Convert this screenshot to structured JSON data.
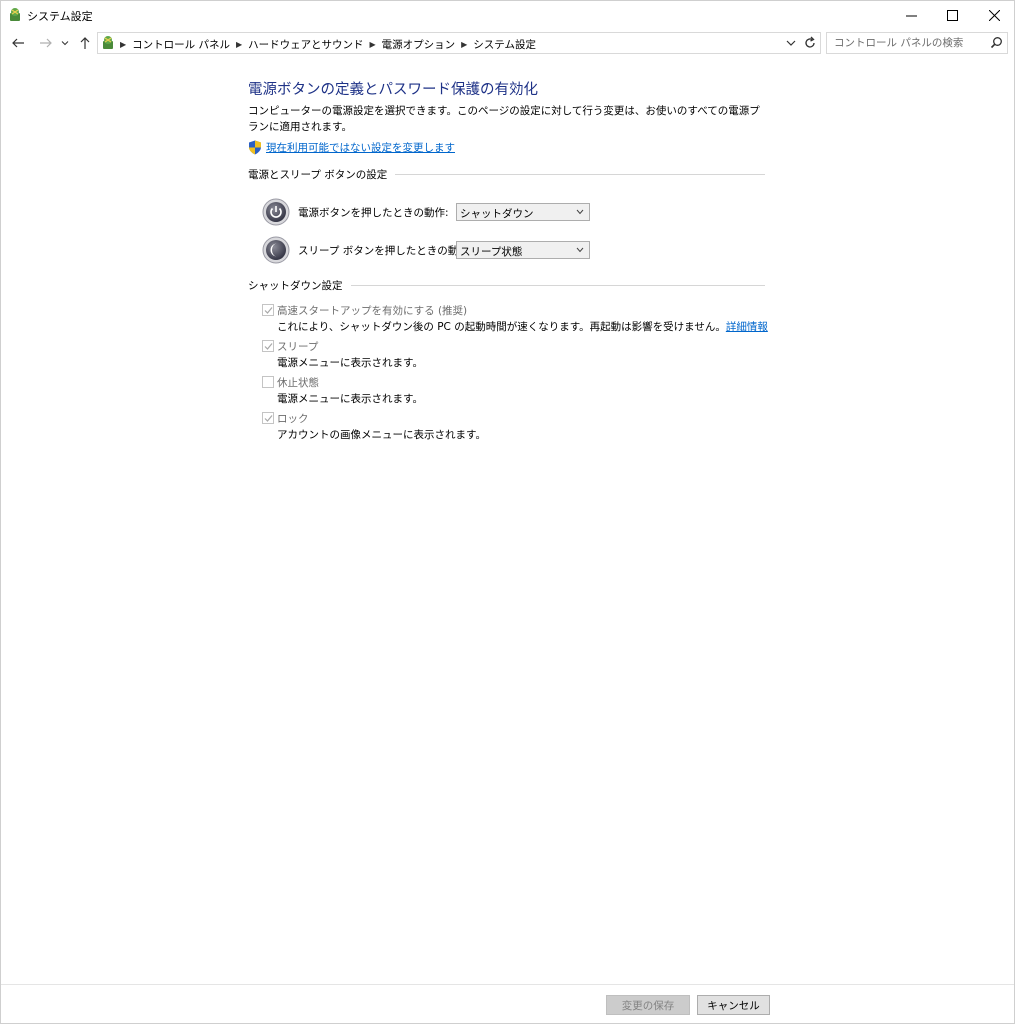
{
  "window": {
    "title": "システム設定"
  },
  "address": {
    "breadcrumbs": [
      "コントロール パネル",
      "ハードウェアとサウンド",
      "電源オプション",
      "システム設定"
    ],
    "search_placeholder": "コントロール パネルの検索"
  },
  "page": {
    "title": "電源ボタンの定義とパスワード保護の有効化",
    "description": "コンピューターの電源設定を選択できます。このページの設定に対して行う変更は、お使いのすべての電源プランに適用されます。",
    "admin_link": "現在利用可能ではない設定を変更します"
  },
  "power_section": {
    "title": "電源とスリープ ボタンの設定",
    "power_button_label": "電源ボタンを押したときの動作:",
    "power_button_value": "シャットダウン",
    "sleep_button_label": "スリープ ボタンを押したときの動作:",
    "sleep_button_value": "スリープ状態"
  },
  "shutdown_section": {
    "title": "シャットダウン設定",
    "items": [
      {
        "label": "高速スタートアップを有効にする (推奨)",
        "desc": "これにより、シャットダウン後の PC の起動時間が速くなります。再起動は影響を受けません。",
        "link": "詳細情報",
        "checked": true
      },
      {
        "label": "スリープ",
        "desc": "電源メニューに表示されます。",
        "checked": true
      },
      {
        "label": "休止状態",
        "desc": "電源メニューに表示されます。",
        "checked": false
      },
      {
        "label": "ロック",
        "desc": "アカウントの画像メニューに表示されます。",
        "checked": true
      }
    ]
  },
  "buttons": {
    "save": "変更の保存",
    "cancel": "キャンセル"
  }
}
